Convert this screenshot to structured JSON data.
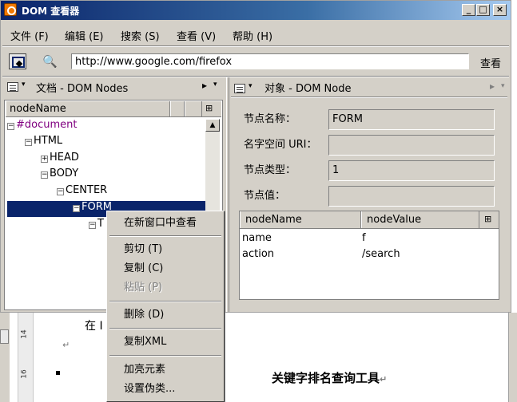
{
  "window": {
    "title": "DOM 查看器",
    "controls": {
      "minimize": "_",
      "maximize": "□",
      "close": "×"
    }
  },
  "menubar": {
    "items": [
      "文件 (F)",
      "编辑 (E)",
      "搜索 (S)",
      "查看 (V)",
      "帮助 (H)"
    ]
  },
  "toolbar": {
    "url": "http://www.google.com/firefox",
    "view_label": "查看"
  },
  "left_panel": {
    "title": "文档 - DOM Nodes",
    "arrow": "▸",
    "column_header": "nodeName",
    "tree": [
      {
        "label": "#document",
        "expander": "−"
      },
      {
        "label": "HTML",
        "expander": "−"
      },
      {
        "label": "HEAD",
        "expander": "+"
      },
      {
        "label": "BODY",
        "expander": "−"
      },
      {
        "label": "CENTER",
        "expander": "−"
      },
      {
        "label": "FORM",
        "expander": "−"
      },
      {
        "label": "T",
        "expander": "−"
      }
    ]
  },
  "right_panel": {
    "title": "对象 - DOM Node",
    "arrow": "▸",
    "fields": [
      {
        "label": "节点名称：",
        "value": "FORM"
      },
      {
        "label": "名字空间 URI：",
        "value": ""
      },
      {
        "label": "节点类型：",
        "value": "1"
      },
      {
        "label": "节点值：",
        "value": ""
      }
    ],
    "attr_table": {
      "headers": [
        "nodeName",
        "nodeValue"
      ],
      "rows": [
        {
          "name": "name",
          "value": "f"
        },
        {
          "name": "action",
          "value": "/search"
        }
      ]
    }
  },
  "context_menu": {
    "items": [
      {
        "label": "在新窗口中查看",
        "enabled": true
      },
      {
        "label": "剪切 (T)",
        "enabled": true
      },
      {
        "label": "复制 (C)",
        "enabled": true
      },
      {
        "label": "粘贴 (P)",
        "enabled": false
      },
      {
        "label": "删除 (D)",
        "enabled": true
      },
      {
        "label": "复制XML",
        "enabled": true
      },
      {
        "label": "加亮元素",
        "enabled": true
      },
      {
        "label": "设置伪类...",
        "enabled": true
      }
    ]
  },
  "background_document": {
    "text_fragment": "在 I",
    "heading": "关键字排名查询工具",
    "return_mark": "↵",
    "ruler_labels": [
      "14",
      "16"
    ]
  },
  "colors": {
    "selection": "#0a246a",
    "chrome": "#d4d0c8",
    "document_node": "#800080"
  }
}
